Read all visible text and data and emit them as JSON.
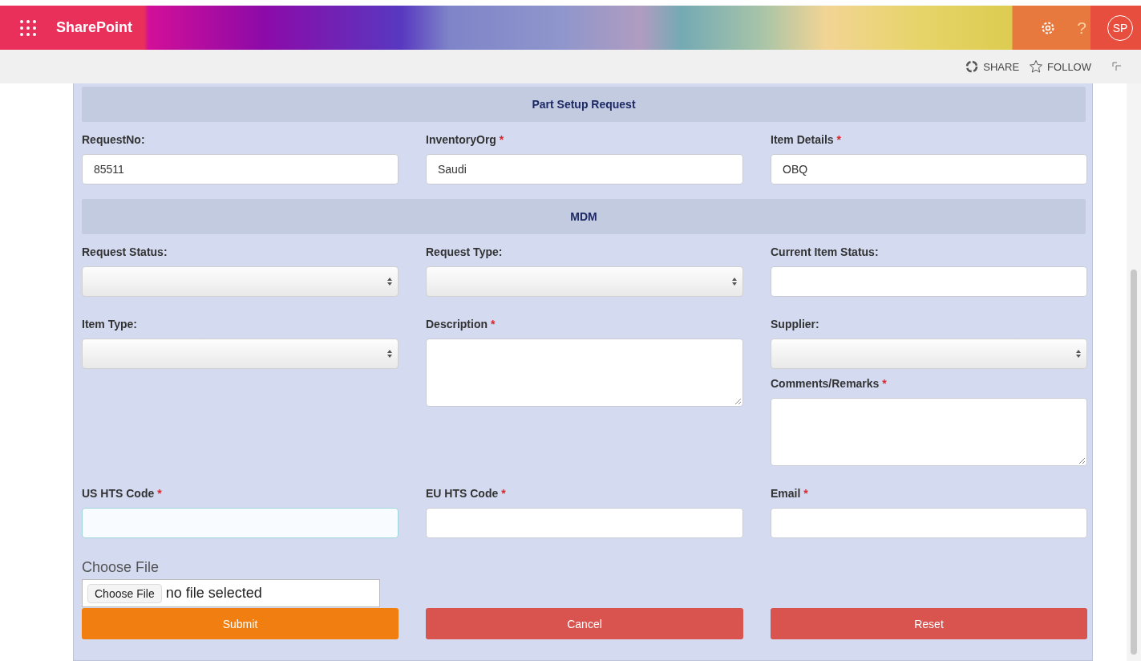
{
  "suite_bar": {
    "app_name": "SharePoint",
    "avatar": "SP",
    "help": "?"
  },
  "command_bar": {
    "share": "SHARE",
    "follow": "FOLLOW"
  },
  "form": {
    "blocks": [
      {
        "kind": "header",
        "title": "Part Setup Request"
      },
      {
        "kind": "fields",
        "columns": [
          [
            {
              "label": "RequestNo:",
              "kind": "text",
              "value": "85511"
            }
          ],
          [
            {
              "label": "InventoryOrg",
              "marker": "*",
              "kind": "text",
              "value": "Saudi"
            }
          ],
          [
            {
              "label": "Item Details",
              "marker": "*",
              "kind": "text",
              "value": "OBQ"
            }
          ]
        ]
      },
      {
        "kind": "header",
        "title": "MDM"
      },
      {
        "kind": "fields",
        "columns": [
          [
            {
              "label": "Request Status:",
              "kind": "select"
            }
          ],
          [
            {
              "label": "Request Type:",
              "kind": "select"
            }
          ],
          [
            {
              "label": "Current Item Status:",
              "kind": "text"
            }
          ]
        ]
      },
      {
        "kind": "fields",
        "columns": [
          [
            {
              "label": "Item Type:",
              "kind": "select"
            }
          ],
          [
            {
              "label": "Description",
              "marker": "*",
              "kind": "textarea"
            }
          ],
          [
            {
              "label": "Supplier:",
              "kind": "select"
            },
            {
              "label": "Comments/Remarks",
              "marker": "*",
              "kind": "textarea"
            }
          ]
        ]
      },
      {
        "kind": "fields",
        "columns": [
          [
            {
              "label": "US HTS Code",
              "marker": "*",
              "kind": "text",
              "focused": true
            }
          ],
          [
            {
              "label": "EU HTS Code",
              "marker": "*",
              "kind": "text",
              "focused": false
            }
          ],
          [
            {
              "label": "Email",
              "marker": "*",
              "kind": "text",
              "focused": false
            }
          ]
        ]
      }
    ],
    "file": {
      "label": "Choose File",
      "button": "Choose File",
      "status": "no file selected"
    },
    "buttons": [
      {
        "label": "Submit",
        "kind": "primary"
      },
      {
        "label": "Cancel",
        "kind": "danger"
      },
      {
        "label": "Reset",
        "kind": "danger"
      }
    ]
  }
}
